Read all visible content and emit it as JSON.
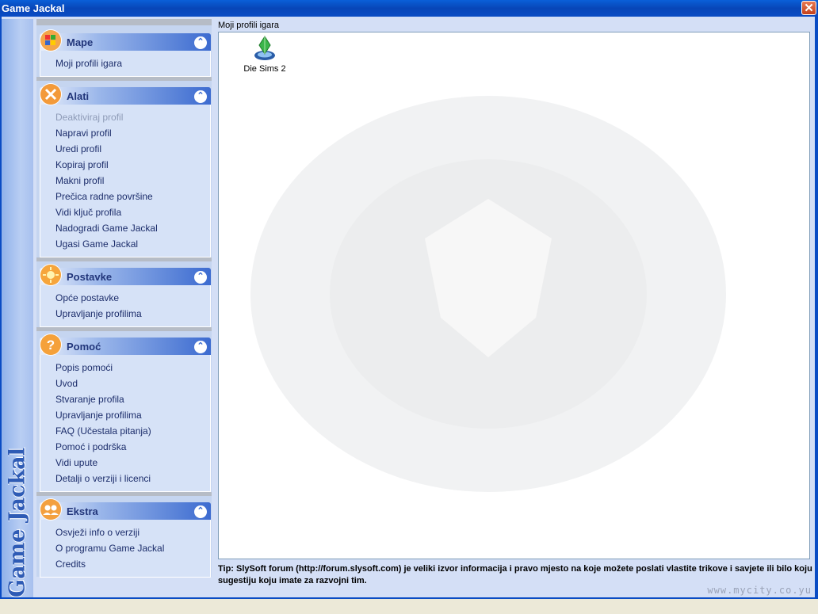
{
  "window": {
    "title": "Game Jackal",
    "close_glyph": "✕"
  },
  "brand": "Game Jackal",
  "taskpane": {
    "groups": [
      {
        "label": "Mape",
        "icon": "windows-flag-icon",
        "items": [
          {
            "label": "Moji profili igara",
            "enabled": true
          }
        ]
      },
      {
        "label": "Alati",
        "icon": "tools-icon",
        "items": [
          {
            "label": "Deaktiviraj profil",
            "enabled": false
          },
          {
            "label": "Napravi profil",
            "enabled": true
          },
          {
            "label": "Uredi profil",
            "enabled": true
          },
          {
            "label": "Kopiraj profil",
            "enabled": true
          },
          {
            "label": "Makni profil",
            "enabled": true
          },
          {
            "label": "Prečica radne površine",
            "enabled": true
          },
          {
            "label": "Vidi ključ profila",
            "enabled": true
          },
          {
            "label": "Nadogradi Game Jackal",
            "enabled": true
          },
          {
            "label": "Ugasi Game Jackal",
            "enabled": true
          }
        ]
      },
      {
        "label": "Postavke",
        "icon": "settings-sun-icon",
        "items": [
          {
            "label": "Opće postavke",
            "enabled": true
          },
          {
            "label": "Upravljanje profilima",
            "enabled": true
          }
        ]
      },
      {
        "label": "Pomoć",
        "icon": "help-icon",
        "items": [
          {
            "label": "Popis pomoći",
            "enabled": true
          },
          {
            "label": "Uvod",
            "enabled": true
          },
          {
            "label": "Stvaranje profila",
            "enabled": true
          },
          {
            "label": "Upravljanje profilima",
            "enabled": true
          },
          {
            "label": "FAQ (Učestala pitanja)",
            "enabled": true
          },
          {
            "label": "Pomoć i podrška",
            "enabled": true
          },
          {
            "label": "Vidi upute",
            "enabled": true
          },
          {
            "label": "Detalji o verziji i licenci",
            "enabled": true
          }
        ]
      },
      {
        "label": "Ekstra",
        "icon": "users-icon",
        "items": [
          {
            "label": "Osvježi info o verziji",
            "enabled": true
          },
          {
            "label": "O programu Game Jackal",
            "enabled": true
          },
          {
            "label": "Credits",
            "enabled": true
          }
        ]
      }
    ]
  },
  "content": {
    "label": "Moji profili igara",
    "profiles": [
      {
        "name": "Die Sims 2",
        "icon": "sims-plumbob-icon"
      }
    ]
  },
  "tip": "Tip: SlySoft forum (http://forum.slysoft.com) je veliki izvor informacija i pravo mjesto na koje možete poslati vlastite trikove i savjete ili bilo koju sugestiju koju imate za razvojni tim.",
  "watermark": "www.mycity.co.yu",
  "colors": {
    "titlebar": "#0a4cc4",
    "taskpane_bg": "#c5d5f0",
    "group_header_end": "#3c6bd0",
    "item_text": "#1b2c6a",
    "disabled_text": "#8e9bb7"
  }
}
